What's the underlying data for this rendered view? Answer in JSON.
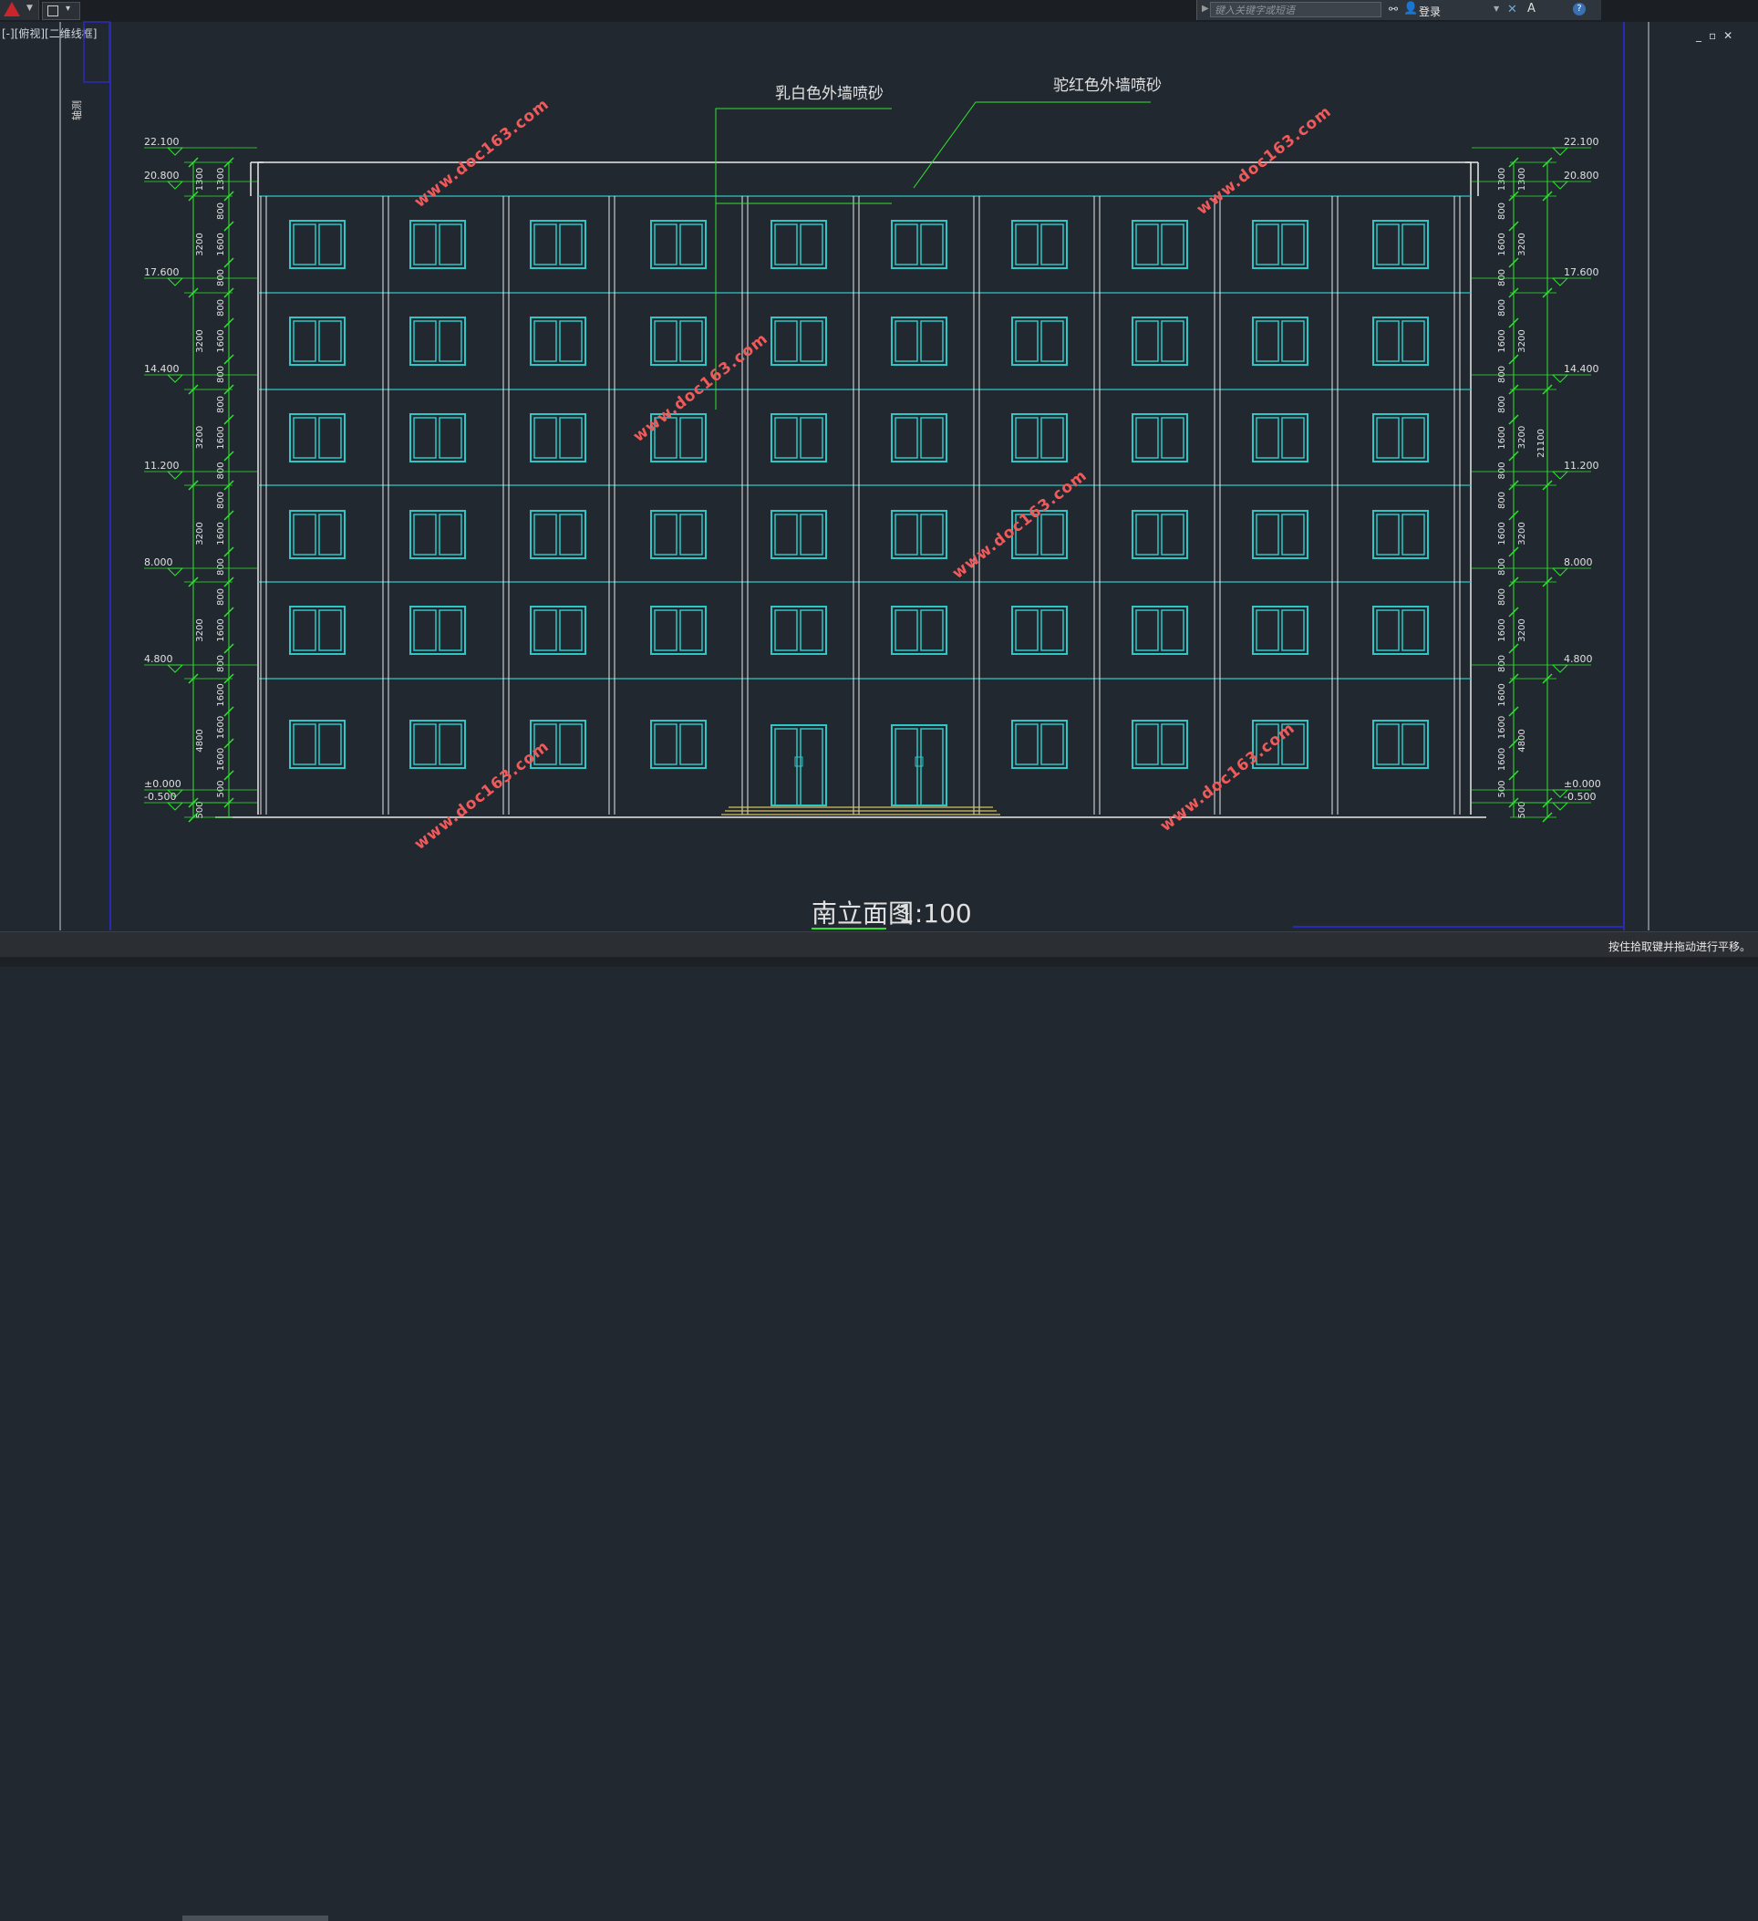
{
  "app": {
    "search_placeholder": "键入关键字或短语",
    "login_label": "登录",
    "viewport_label": "[-][俯视][二维线框]",
    "command_hint": "按住拾取键并拖动进行平移。"
  },
  "drawing": {
    "title": "南立面图",
    "scale": "1:100",
    "annotations": [
      "乳白色外墙喷砂",
      "驼红色外墙喷砂"
    ],
    "watermark": "www.doc163.com",
    "elevation_levels": [
      "22.100",
      "20.800",
      "17.600",
      "14.400",
      "11.200",
      "8.000",
      "4.800",
      "±0.000",
      "-0.500"
    ],
    "dims_inner": [
      "1300",
      "800",
      "1600",
      "800",
      "800",
      "1600",
      "800",
      "800",
      "1600",
      "800",
      "800",
      "1600",
      "800",
      "800",
      "1600",
      "800",
      "1600",
      "1600",
      "1600",
      "500"
    ],
    "dims_floor": [
      "1300",
      "3200",
      "3200",
      "3200",
      "3200",
      "3200",
      "4800",
      "500"
    ],
    "total_height": "21100",
    "side_label": "轴测"
  },
  "colors": {
    "window": "#2fc6c6",
    "facade_line": "#e8e8e8",
    "dimension": "#2ee62e",
    "text": "#e0e0e0",
    "background": "#212830"
  }
}
